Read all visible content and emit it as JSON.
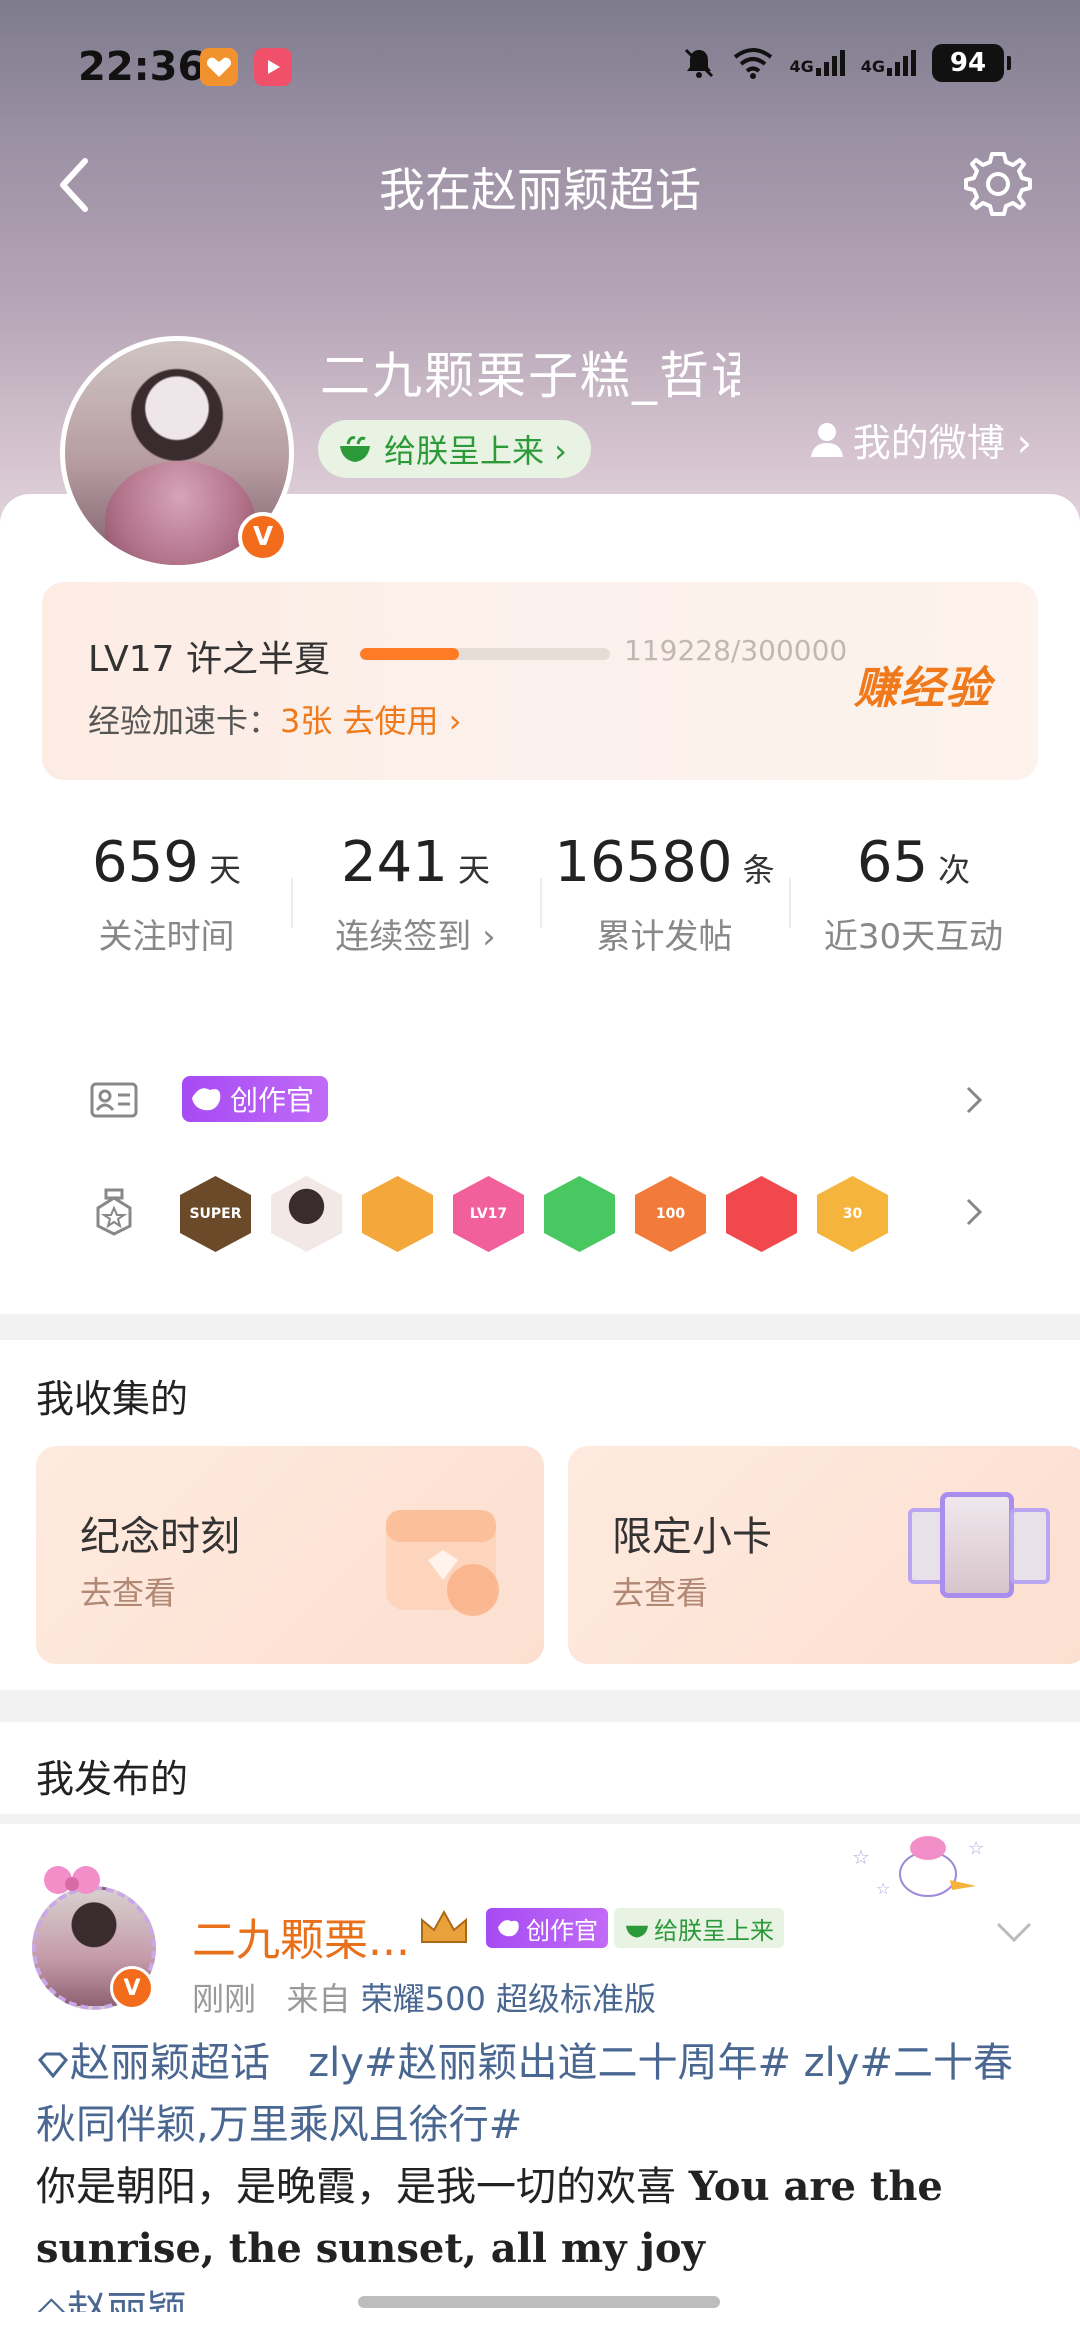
{
  "status_bar": {
    "time": "22:36",
    "network_1": "4G",
    "network_2": "4G",
    "battery": "94"
  },
  "nav": {
    "title": "我在赵丽颖超话"
  },
  "profile": {
    "username": "二九颗栗子糕_哲语",
    "emperor_badge": "给朕呈上来 ›",
    "my_weibo": "我的微博 ›",
    "verified": "V"
  },
  "level": {
    "name": "LV17 许之半夏",
    "exp": "119228/300000",
    "progress": 0.397,
    "card_label": "经验加速卡：",
    "card_value": "3张 去使用 ›",
    "earn": "赚经验"
  },
  "stats": [
    {
      "value": "659",
      "unit": "天",
      "label": "关注时间"
    },
    {
      "value": "241",
      "unit": "天",
      "label": "连续签到 ›"
    },
    {
      "value": "16580",
      "unit": "条",
      "label": "累计发帖"
    },
    {
      "value": "65",
      "unit": "次",
      "label": "近30天互动"
    }
  ],
  "badges": {
    "creator_tag": "创作官",
    "medals": [
      {
        "name": "super-medal",
        "label": "SUPER",
        "color": "#6b4a2a"
      },
      {
        "name": "avatar-medal",
        "label": "",
        "color": "#efe8e4"
      },
      {
        "name": "crown-medal",
        "label": "",
        "color": "#f4a73a"
      },
      {
        "name": "lv17-medal",
        "label": "LV17",
        "color": "#f1609b"
      },
      {
        "name": "hand-medal",
        "label": "",
        "color": "#49c760"
      },
      {
        "name": "100-days-medal",
        "label": "100",
        "color": "#f27a3a"
      },
      {
        "name": "trophy-medal",
        "label": "",
        "color": "#f0484d"
      },
      {
        "name": "30-days-medal",
        "label": "30",
        "color": "#f5b53d"
      }
    ]
  },
  "collected": {
    "title": "我收集的",
    "cards": [
      {
        "title": "纪念时刻",
        "sub": "去查看"
      },
      {
        "title": "限定小卡",
        "sub": "去查看"
      }
    ]
  },
  "published": {
    "title": "我发布的",
    "post": {
      "author": "二九颗栗...",
      "creator_tag": "创作官",
      "emperor_tag": "给朕呈上来",
      "time": "刚刚",
      "from_label": "来自",
      "source": "荣耀500 超级标准版",
      "topic": "赵丽颖超话",
      "text_1": "zly#赵丽颖出道二十周年# zly#二十春秋同伴颖,万里乘风且徐行#",
      "text_2": "你是朝阳，是晚霞，是我一切的欢喜",
      "text_en": "You are the sunrise, the sunset, all my joy",
      "text_clip": "◇赵丽颖"
    }
  }
}
